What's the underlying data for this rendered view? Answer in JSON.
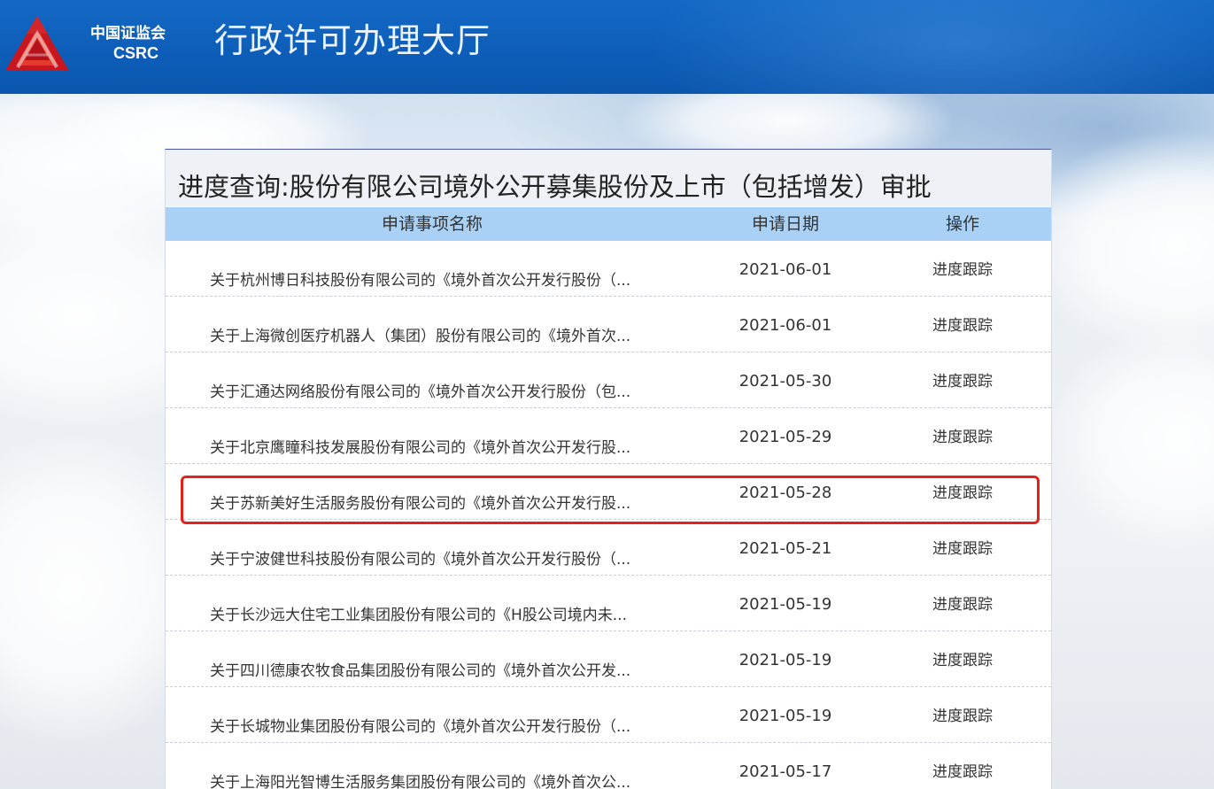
{
  "header": {
    "org_name": "中国证监会",
    "org_abbr": "CSRC",
    "site_title": "行政许可办理大厅",
    "brand_color": "#0d5db8"
  },
  "panel": {
    "title": "进度查询:股份有限公司境外公开募集股份及上市（包括增发）审批",
    "columns": {
      "name": "申请事项名称",
      "date": "申请日期",
      "action": "操作"
    },
    "rows": [
      {
        "name": "关于杭州博日科技股份有限公司的《境外首次公开发行股份（...",
        "date": "2021-06-01",
        "action": "进度跟踪"
      },
      {
        "name": "关于上海微创医疗机器人（集团）股份有限公司的《境外首次...",
        "date": "2021-06-01",
        "action": "进度跟踪"
      },
      {
        "name": "关于汇通达网络股份有限公司的《境外首次公开发行股份（包...",
        "date": "2021-05-30",
        "action": "进度跟踪"
      },
      {
        "name": "关于北京鹰瞳科技发展股份有限公司的《境外首次公开发行股...",
        "date": "2021-05-29",
        "action": "进度跟踪"
      },
      {
        "name": "关于苏新美好生活服务股份有限公司的《境外首次公开发行股...",
        "date": "2021-05-28",
        "action": "进度跟踪"
      },
      {
        "name": "关于宁波健世科技股份有限公司的《境外首次公开发行股份（...",
        "date": "2021-05-21",
        "action": "进度跟踪"
      },
      {
        "name": "关于长沙远大住宅工业集团股份有限公司的《H股公司境内未...",
        "date": "2021-05-19",
        "action": "进度跟踪"
      },
      {
        "name": "关于四川德康农牧食品集团股份有限公司的《境外首次公开发...",
        "date": "2021-05-19",
        "action": "进度跟踪"
      },
      {
        "name": "关于长城物业集团股份有限公司的《境外首次公开发行股份（...",
        "date": "2021-05-19",
        "action": "进度跟踪"
      },
      {
        "name": "关于上海阳光智博生活服务集团股份有限公司的《境外首次公...",
        "date": "2021-05-17",
        "action": "进度跟踪"
      }
    ],
    "highlight_color": "#e2231a",
    "header_row_color": "#a9d1f6"
  }
}
